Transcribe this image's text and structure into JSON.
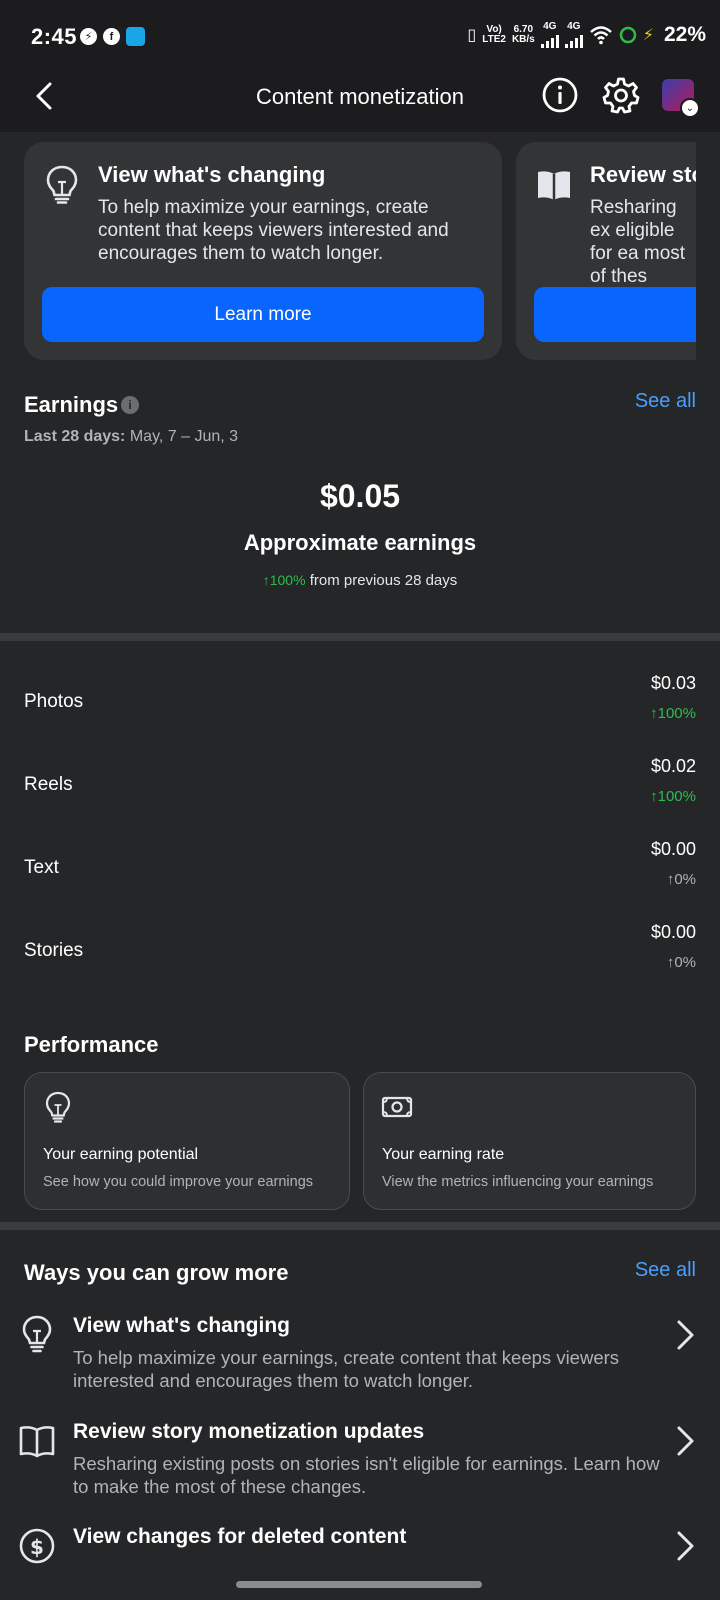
{
  "status_bar": {
    "time": "2:45",
    "volte": "Vo)",
    "lte": "LTE2",
    "speed": "6.70",
    "speed_unit": "KB/s",
    "net1": "4G",
    "net2": "4G",
    "battery": "22%"
  },
  "header": {
    "title": "Content monetization",
    "icons": [
      "back-icon",
      "info-icon",
      "gear-icon",
      "avatar"
    ]
  },
  "promo_cards": [
    {
      "title": "View what's changing",
      "description": "To help maximize your earnings, create content that keeps viewers interested and encourages them to watch longer.",
      "button": "Learn more",
      "icon": "lightbulb-icon"
    },
    {
      "title": "Review sto",
      "description": "Resharing ex eligible for ea most of thes",
      "button": "",
      "icon": "book-icon"
    }
  ],
  "earnings": {
    "heading": "Earnings",
    "see_all": "See all",
    "period_label": "Last 28 days:",
    "period_value": "May, 7 – Jun, 3",
    "total": "$0.05",
    "total_label": "Approximate earnings",
    "change_value": "↑100%",
    "change_text": "from previous 28 days",
    "rows": [
      {
        "label": "Photos",
        "value": "$0.03",
        "change": "↑100%",
        "change_color": "#2fbc4d"
      },
      {
        "label": "Reels",
        "value": "$0.02",
        "change": "↑100%",
        "change_color": "#2fbc4d"
      },
      {
        "label": "Text",
        "value": "$0.00",
        "change": "↑0%",
        "change_color": "#b0b3b8"
      },
      {
        "label": "Stories",
        "value": "$0.00",
        "change": "↑0%",
        "change_color": "#b0b3b8"
      }
    ]
  },
  "performance": {
    "heading": "Performance",
    "cards": [
      {
        "title": "Your earning potential",
        "description": "See how you could improve your earnings",
        "icon": "lightbulb-icon"
      },
      {
        "title": "Your earning rate",
        "description": "View the metrics influencing your earnings",
        "icon": "money-icon"
      }
    ]
  },
  "grow": {
    "heading": "Ways you can grow more",
    "see_all": "See all",
    "items": [
      {
        "title": "View what's changing",
        "description": "To help maximize your earnings, create content that keeps viewers interested and encourages them to watch longer.",
        "icon": "lightbulb-icon"
      },
      {
        "title": "Review story monetization updates",
        "description": "Resharing existing posts on stories isn't eligible for earnings. Learn how to make the most of these changes.",
        "icon": "book-icon"
      },
      {
        "title": "View changes for deleted content",
        "description": "",
        "icon": "dollar-circle-icon"
      }
    ]
  },
  "colors": {
    "background": "#252628",
    "card": "#333436",
    "accent_blue": "#0866ff",
    "link_blue": "#4a9eff",
    "positive_green": "#2fbc4d"
  }
}
